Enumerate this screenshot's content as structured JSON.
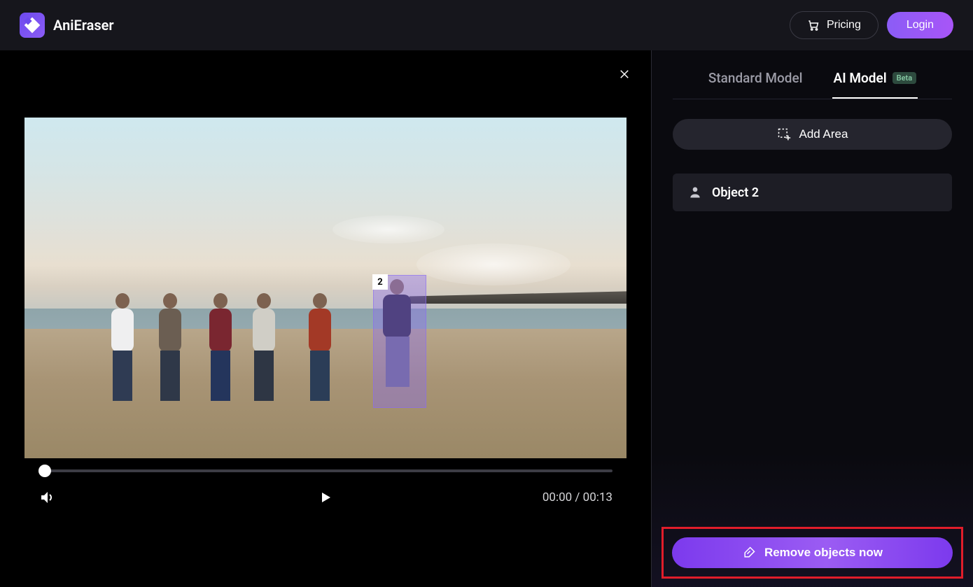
{
  "header": {
    "app_name": "AniEraser",
    "pricing_label": "Pricing",
    "login_label": "Login"
  },
  "video": {
    "selection_number": "2",
    "current_time": "00:00",
    "total_time": "00:13"
  },
  "sidebar": {
    "tabs": {
      "standard": "Standard Model",
      "ai": "AI Model",
      "badge": "Beta"
    },
    "add_area_label": "Add Area",
    "objects": [
      {
        "label": "Object 2"
      }
    ],
    "remove_label": "Remove objects now"
  },
  "colors": {
    "accent": "#8b5cf6",
    "highlight_border": "#e11d2a",
    "selection_overlay": "rgba(138,106,245,0.38)"
  }
}
